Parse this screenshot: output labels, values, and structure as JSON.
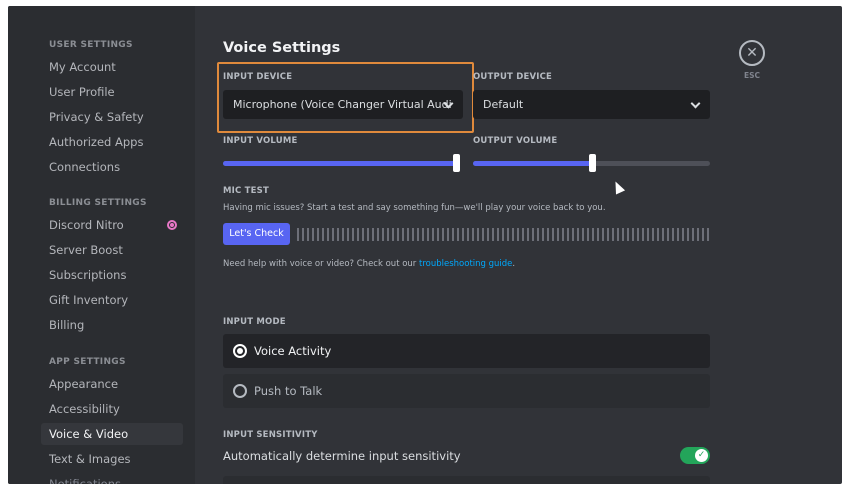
{
  "sidebar": {
    "sections": [
      {
        "header": "USER SETTINGS",
        "items": [
          "My Account",
          "User Profile",
          "Privacy & Safety",
          "Authorized Apps",
          "Connections"
        ]
      },
      {
        "header": "BILLING SETTINGS",
        "items": [
          "Discord Nitro",
          "Server Boost",
          "Subscriptions",
          "Gift Inventory",
          "Billing"
        ]
      },
      {
        "header": "APP SETTINGS",
        "items": [
          "Appearance",
          "Accessibility",
          "Voice & Video",
          "Text & Images",
          "Notifications"
        ]
      }
    ],
    "selected": "Voice & Video"
  },
  "main": {
    "title": "Voice Settings",
    "input_device": {
      "label": "INPUT DEVICE",
      "value": "Microphone (Voice Changer Virtual Audi"
    },
    "output_device": {
      "label": "OUTPUT DEVICE",
      "value": "Default"
    },
    "input_volume": {
      "label": "INPUT VOLUME",
      "level": 1.0
    },
    "output_volume": {
      "label": "OUTPUT VOLUME",
      "level": 0.5
    },
    "mic_test": {
      "label": "MIC TEST",
      "description": "Having mic issues? Start a test and say something fun—we'll play your voice back to you.",
      "button": "Let's Check"
    },
    "help": {
      "text": "Need help with voice or video? Check out our ",
      "link": "troubleshooting guide",
      "suffix": "."
    },
    "input_mode": {
      "label": "INPUT MODE",
      "options": [
        "Voice Activity",
        "Push to Talk"
      ],
      "selected": "Voice Activity"
    },
    "input_sensitivity": {
      "label": "INPUT SENSITIVITY",
      "auto_label": "Automatically determine input sensitivity",
      "auto_enabled": true
    },
    "close": {
      "icon": "close-icon",
      "label": "ESC"
    }
  },
  "colors": {
    "accent": "#5865f2",
    "highlight_box": "#e08a3c",
    "toggle_on": "#23a55a",
    "nitro": "#e978c8"
  }
}
